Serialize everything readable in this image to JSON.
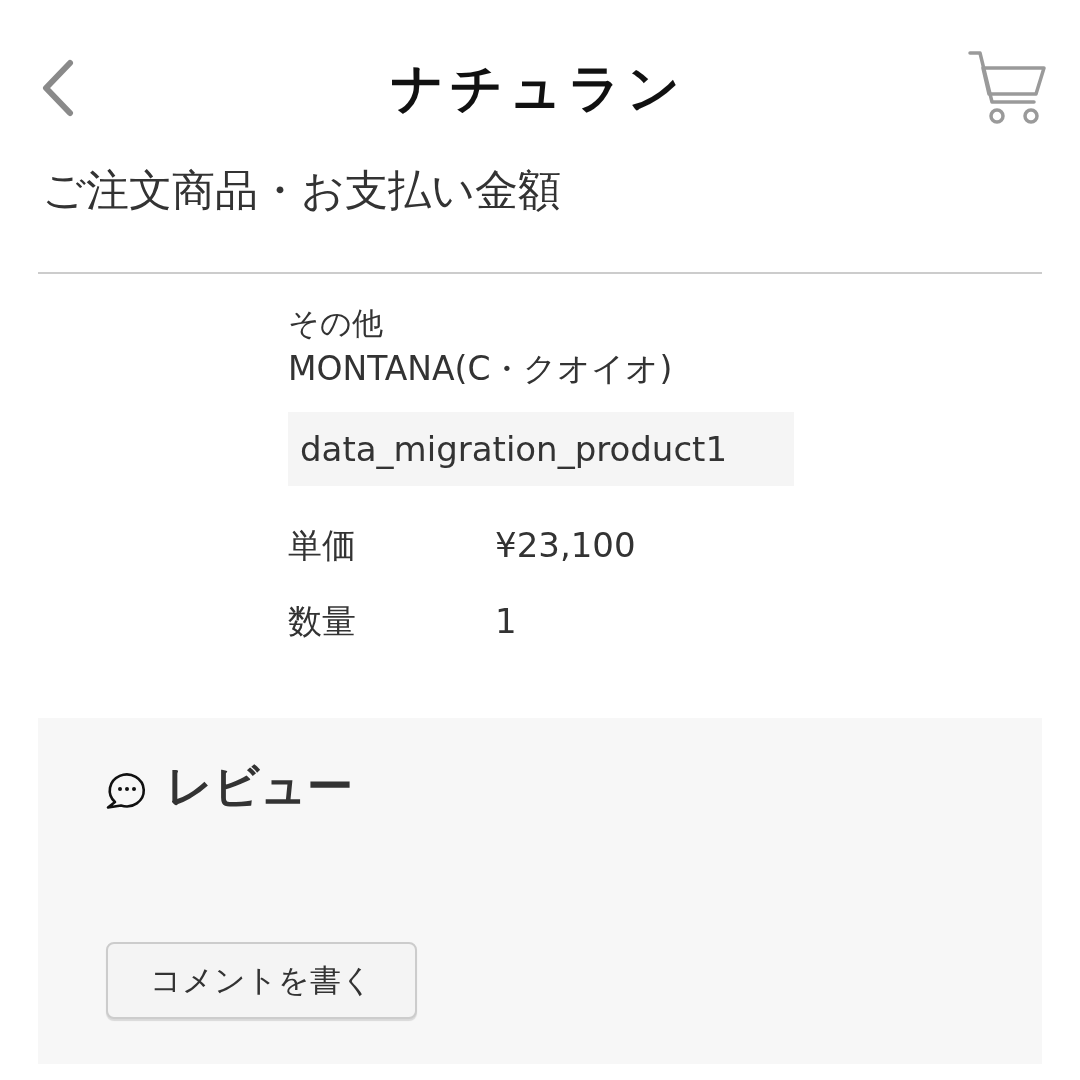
{
  "header": {
    "title": "ナチュラン"
  },
  "section": {
    "title": "ご注文商品・お支払い金額"
  },
  "product": {
    "category": "その他",
    "name": "MONTANA(C・クオイオ)",
    "code": "data_migration_product1",
    "details": [
      {
        "label": "単価",
        "value": "¥23,100"
      },
      {
        "label": "数量",
        "value": "1"
      }
    ]
  },
  "review": {
    "title": "レビュー",
    "button": "コメントを書く"
  }
}
